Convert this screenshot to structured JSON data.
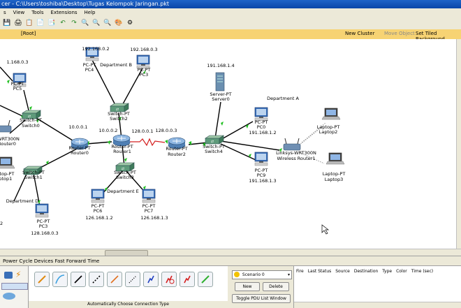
{
  "window": {
    "title": "cer - C:\\Users\\toshiba\\Desktop\\Tugas Kelompok Jaringan.pkt"
  },
  "menu": [
    "s",
    "View",
    "Tools",
    "Extensions",
    "Help"
  ],
  "logical_bar": {
    "root": "[Root]",
    "new_cluster": "New Cluster",
    "move_object": "Move Object",
    "set_tiled": "Set Tiled Background"
  },
  "nodes": [
    {
      "id": "pc4",
      "type": "pc",
      "line1": "PC-PT",
      "line2": "PC4",
      "ip": "192.168.0.2"
    },
    {
      "id": "pc3a",
      "type": "pc",
      "line1": "PC-PT",
      "line2": "PC3",
      "ip": "192.168.0.3"
    },
    {
      "id": "dept_b",
      "type": "label",
      "text": "Department B"
    },
    {
      "id": "pc_left",
      "type": "pc",
      "line1": "PC-PT",
      "line2": "PC5",
      "ip": "1.168.0.3"
    },
    {
      "id": "switch2",
      "type": "switch",
      "line1": "Switch-PT",
      "line2": "Switch2"
    },
    {
      "id": "switch0",
      "type": "switch",
      "line1": "Switch-PT",
      "line2": "Switch0"
    },
    {
      "id": "router0",
      "type": "router",
      "line1": "Router-PT",
      "line2": "Router0",
      "ip": "10.0.0.1"
    },
    {
      "id": "router1",
      "type": "router",
      "line1": "Router-PT",
      "line2": "Router1",
      "ip": "10.0.0.2"
    },
    {
      "id": "router2",
      "type": "router",
      "line1": "Router-PT",
      "line2": "Router2",
      "ip": "128.0.0.3"
    },
    {
      "id": "link_ip",
      "type": "label",
      "text": "128.0.0.1"
    },
    {
      "id": "server",
      "type": "server",
      "line1": "Server-PT",
      "line2": "Server0",
      "ip": "191.168.1.4"
    },
    {
      "id": "dept_a",
      "type": "label",
      "text": "Department A"
    },
    {
      "id": "switch4",
      "type": "switch",
      "line1": "Switch-PT",
      "line2": "Switch4"
    },
    {
      "id": "pc0",
      "type": "pc",
      "line1": "PC-PT",
      "line2": "PC0",
      "ip": "191.168.1.2"
    },
    {
      "id": "pc9",
      "type": "pc",
      "line1": "PC-PT",
      "line2": "PC9",
      "ip": "191.168.1.3"
    },
    {
      "id": "wrouter",
      "type": "wrouter",
      "line1": "Linksys-WRT300N",
      "line2": "Wireless Router1"
    },
    {
      "id": "laptop2",
      "type": "laptop",
      "line1": "Laptop-PT",
      "line2": "Laptop2"
    },
    {
      "id": "laptop3",
      "type": "laptop",
      "line1": "Laptop-PT",
      "line2": "Laptop3"
    },
    {
      "id": "wrt_left",
      "type": "label",
      "text": "WRT300N"
    },
    {
      "id": "router_left",
      "type": "label",
      "text": "Router0"
    },
    {
      "id": "laptop_left",
      "type": "laptop",
      "line1": "Laptop-PT",
      "line2": "Laptop1"
    },
    {
      "id": "switch1",
      "type": "switch",
      "line1": "Switch-PT",
      "line2": "Switch1"
    },
    {
      "id": "dept_d",
      "type": "label",
      "text": "Department D"
    },
    {
      "id": "pc3b",
      "type": "pc",
      "line1": "PC-PT",
      "line2": "PC3",
      "ip": "128.168.0.3"
    },
    {
      "id": "switch3",
      "type": "switch",
      "line1": "Switch-PT",
      "line2": "Switch3"
    },
    {
      "id": "dept_e",
      "type": "label",
      "text": "Department E"
    },
    {
      "id": "pc6",
      "type": "pc",
      "line1": "PC-PT",
      "line2": "PC6",
      "ip": "126.168.1.2"
    },
    {
      "id": "pc7",
      "type": "pc",
      "line1": "PC-PT",
      "line2": "PC7",
      "ip": "126.168.1.3"
    },
    {
      "id": "stray",
      "type": "label",
      "text": "2"
    }
  ],
  "time_bar": {
    "label": "Power Cycle Devices  Fast Forward Time"
  },
  "connections_caption": "Automatically Choose Connection Type",
  "scenario": {
    "selected": "Scenario 0",
    "new": "New",
    "delete": "Delete",
    "toggle": "Toggle PDU List Window"
  },
  "pdu_columns": [
    "Fire",
    "Last Status",
    "Source",
    "Destination",
    "Type",
    "Color",
    "Time (sec)"
  ],
  "colors": {
    "link": "#000000",
    "serial": "#d42020",
    "port_up": "#22c022",
    "pc_blue": "#3a6fb8"
  }
}
